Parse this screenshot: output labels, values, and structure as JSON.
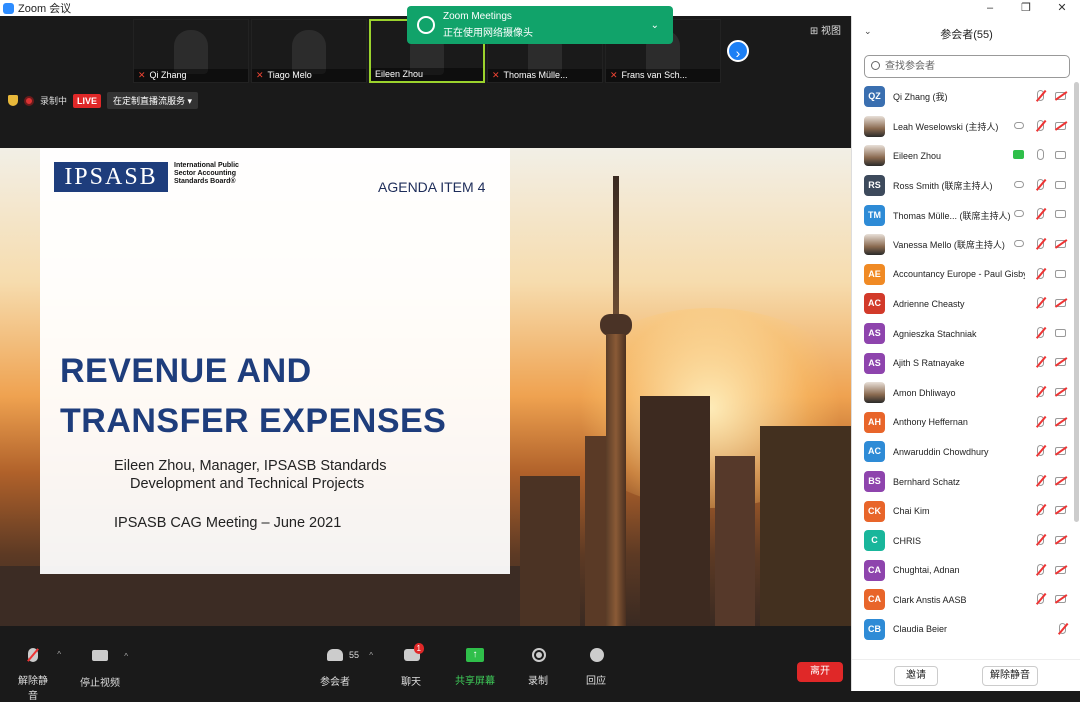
{
  "window": {
    "title": "Zoom 会议",
    "controls": [
      "–",
      "❐",
      "✕"
    ]
  },
  "notification": {
    "title": "Zoom Meetings",
    "message": "正在使用网络摄像头"
  },
  "view_label": "⊞ 视图",
  "thumbnails": [
    {
      "name": "Qi Zhang"
    },
    {
      "name": "Tiago Melo"
    },
    {
      "name": "Eileen Zhou"
    },
    {
      "name": "Thomas Mülle..."
    },
    {
      "name": "Frans van Sch..."
    }
  ],
  "recording": {
    "label": "录制中",
    "live": "LIVE",
    "stream": "在定制直播流服务"
  },
  "slide": {
    "logo": "IPSASB",
    "logo_sub": "International Public Sector Accounting Standards Board®",
    "agenda": "AGENDA ITEM 4",
    "headline_line1": "REVENUE AND",
    "headline_line2": "TRANSFER EXPENSES",
    "presenter_line1": "Eileen Zhou, Manager, IPSASB Standards",
    "presenter_line2": "Development and Technical Projects",
    "meeting": "IPSASB CAG Meeting – June 2021"
  },
  "toolbar": {
    "unmute": "解除静音",
    "stop_video": "停止视频",
    "participants": "参会者",
    "participants_count": "55",
    "chat": "聊天",
    "chat_badge": "1",
    "share": "共享屏幕",
    "record": "录制",
    "reactions": "回应",
    "leave": "离开"
  },
  "sidebar": {
    "title": "参会者(55)",
    "search_placeholder": "查找参会者",
    "invite": "邀请",
    "unmute_all": "解除静音",
    "participants": [
      {
        "initials": "QZ",
        "color": "#3a6fb0",
        "name": "Qi Zhang (我)",
        "photo": false
      },
      {
        "initials": "",
        "color": "",
        "name": "Leah Weselowski (主持人)",
        "photo": true
      },
      {
        "initials": "",
        "color": "",
        "name": "Eileen Zhou",
        "photo": true
      },
      {
        "initials": "RS",
        "color": "#3d4a5c",
        "name": "Ross Smith (联席主持人)",
        "photo": false
      },
      {
        "initials": "TM",
        "color": "#2e8bd6",
        "name": "Thomas Mülle... (联席主持人)",
        "photo": false
      },
      {
        "initials": "",
        "color": "",
        "name": "Vanessa Mello (联席主持人)",
        "photo": true
      },
      {
        "initials": "AE",
        "color": "#f08a24",
        "name": "Accountancy Europe - Paul Gisby",
        "photo": false
      },
      {
        "initials": "AC",
        "color": "#d23a2a",
        "name": "Adrienne Cheasty",
        "photo": false
      },
      {
        "initials": "AS",
        "color": "#8e44ad",
        "name": "Agnieszka Stachniak",
        "photo": false
      },
      {
        "initials": "AS",
        "color": "#8e44ad",
        "name": "Ajith S Ratnayake",
        "photo": false
      },
      {
        "initials": "",
        "color": "",
        "name": "Amon Dhliwayo",
        "photo": true
      },
      {
        "initials": "AH",
        "color": "#e8652a",
        "name": "Anthony Heffernan",
        "photo": false
      },
      {
        "initials": "AC",
        "color": "#2e8bd6",
        "name": "Anwaruddin Chowdhury",
        "photo": false
      },
      {
        "initials": "BS",
        "color": "#8e44ad",
        "name": "Bernhard Schatz",
        "photo": false
      },
      {
        "initials": "CK",
        "color": "#e8652a",
        "name": "Chai Kim",
        "photo": false
      },
      {
        "initials": "C",
        "color": "#19b69b",
        "name": "CHRIS",
        "photo": false
      },
      {
        "initials": "CA",
        "color": "#8e44ad",
        "name": "Chughtai, Adnan",
        "photo": false
      },
      {
        "initials": "CA",
        "color": "#e8652a",
        "name": "Clark Anstis AASB",
        "photo": false
      },
      {
        "initials": "CB",
        "color": "#2e8bd6",
        "name": "Claudia Beier",
        "photo": false
      }
    ]
  }
}
